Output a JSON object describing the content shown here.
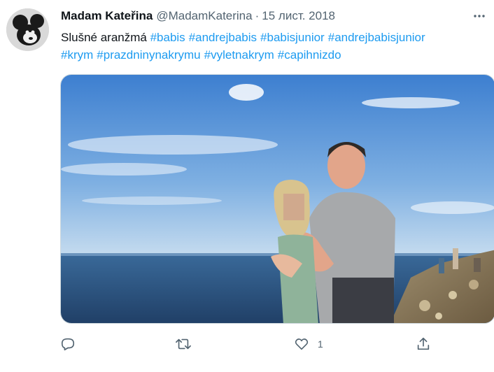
{
  "tweet": {
    "author_name": "Madam Kateřina",
    "author_handle": "@MadamKaterina",
    "separator": "·",
    "date": "15 лист. 2018",
    "text_intro": "Slušné aranžmá",
    "hashtags_line1": [
      "#babis",
      "#andrejbabis",
      "#babisjunior",
      "#andrejbabisjunior"
    ],
    "hashtags_line2": [
      "#krym",
      "#prazdninynakrymu",
      "#vyletnakrym",
      "#capihnizdo"
    ]
  },
  "actions": {
    "reply_icon": "reply-icon",
    "retweet_icon": "retweet-icon",
    "like_icon": "heart-icon",
    "like_count": "1",
    "share_icon": "share-icon"
  },
  "colors": {
    "link": "#1d9bf0",
    "secondary_text": "#536471",
    "primary_text": "#0f1419"
  }
}
